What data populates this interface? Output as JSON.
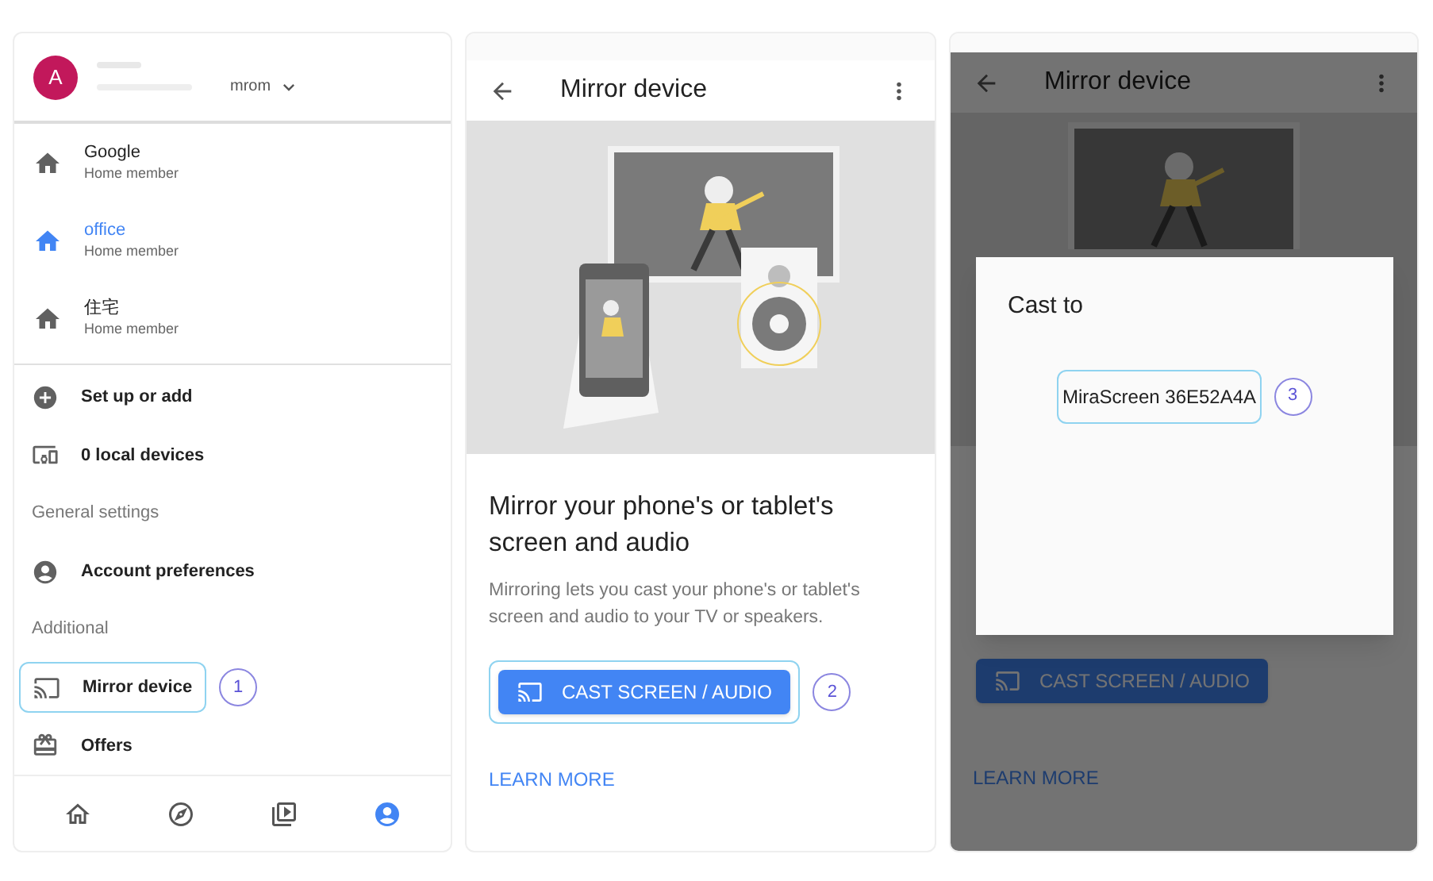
{
  "drawer": {
    "avatar": "A",
    "account": "mrom",
    "homes": [
      {
        "name": "Google",
        "role": "Home member",
        "selected": false
      },
      {
        "name": "office",
        "role": "Home member",
        "selected": true
      },
      {
        "name": "住宅",
        "role": "Home member",
        "selected": false
      }
    ],
    "menu": [
      {
        "kind": "add",
        "label": "Set up or add"
      },
      {
        "kind": "devices",
        "label": "0 local devices"
      },
      {
        "kind": "section",
        "label": "General settings"
      },
      {
        "kind": "account",
        "label": "Account preferences"
      },
      {
        "kind": "section",
        "label": "Additional"
      },
      {
        "kind": "cast",
        "label": "Mirror device",
        "callout": "1"
      },
      {
        "kind": "gift",
        "label": "Offers"
      }
    ],
    "bottom_nav": [
      {
        "kind": "home",
        "selected": false
      },
      {
        "kind": "explore",
        "selected": false
      },
      {
        "kind": "media",
        "selected": false
      },
      {
        "kind": "profile",
        "selected": true
      }
    ]
  },
  "mirror_screen": {
    "title": "Mirror device",
    "heading": "Mirror your phone's or tablet's screen and audio",
    "description": "Mirroring lets you cast your phone's or tablet's screen and audio to your TV or speakers.",
    "button": "CAST SCREEN / AUDIO",
    "callout": "2",
    "link": "LEARN MORE"
  },
  "cast_screen": {
    "title": "Mirror device",
    "button": "CAST SCREEN / AUDIO",
    "link": "LEARN MORE",
    "dialog": {
      "title": "Cast to",
      "devices": [
        {
          "name": "MiraScreen 36E52A4A",
          "callout": "3"
        }
      ]
    }
  }
}
